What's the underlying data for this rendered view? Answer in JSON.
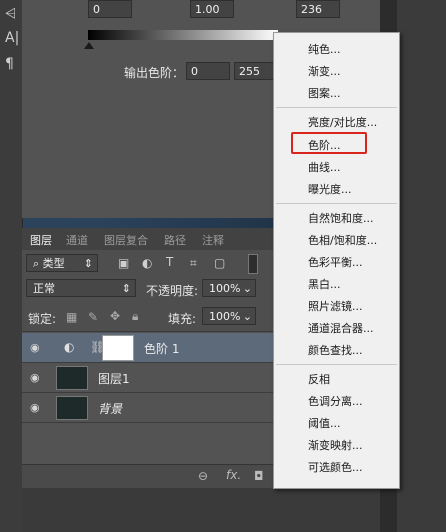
{
  "levels": {
    "input_black": "0",
    "input_gamma": "1.00",
    "input_white": "236",
    "output_label": "输出色阶：",
    "output_black": "0",
    "output_white": "255"
  },
  "layers_panel": {
    "tabs": [
      "图层",
      "通道",
      "图层复合",
      "路径",
      "注释"
    ],
    "filter_kind": "类型",
    "blend_mode": "正常",
    "opacity_label": "不透明度:",
    "opacity_value": "100%",
    "lock_label": "锁定:",
    "fill_label": "填充:",
    "fill_value": "100%",
    "layers": [
      {
        "name": "色阶 1",
        "selected": true
      },
      {
        "name": "图层1",
        "selected": false
      },
      {
        "name": "背景",
        "selected": false
      }
    ],
    "footer_icons": [
      "link-icon",
      "fx-icon",
      "mask-icon"
    ],
    "footer_fx": "fx."
  },
  "left_toolbar": {
    "glyphs": [
      "A|",
      "¶"
    ]
  },
  "menu": {
    "groups": [
      [
        "纯色...",
        "渐变...",
        "图案..."
      ],
      [
        "亮度/对比度...",
        "色阶...",
        "曲线...",
        "曝光度..."
      ],
      [
        "自然饱和度...",
        "色相/饱和度...",
        "色彩平衡...",
        "黑白...",
        "照片滤镜...",
        "通道混合器...",
        "颜色查找..."
      ],
      [
        "反相",
        "色调分离...",
        "阈值...",
        "渐变映射...",
        "可选颜色..."
      ]
    ],
    "highlighted_item": "色阶...",
    "highlight_color": "#d9261c"
  }
}
